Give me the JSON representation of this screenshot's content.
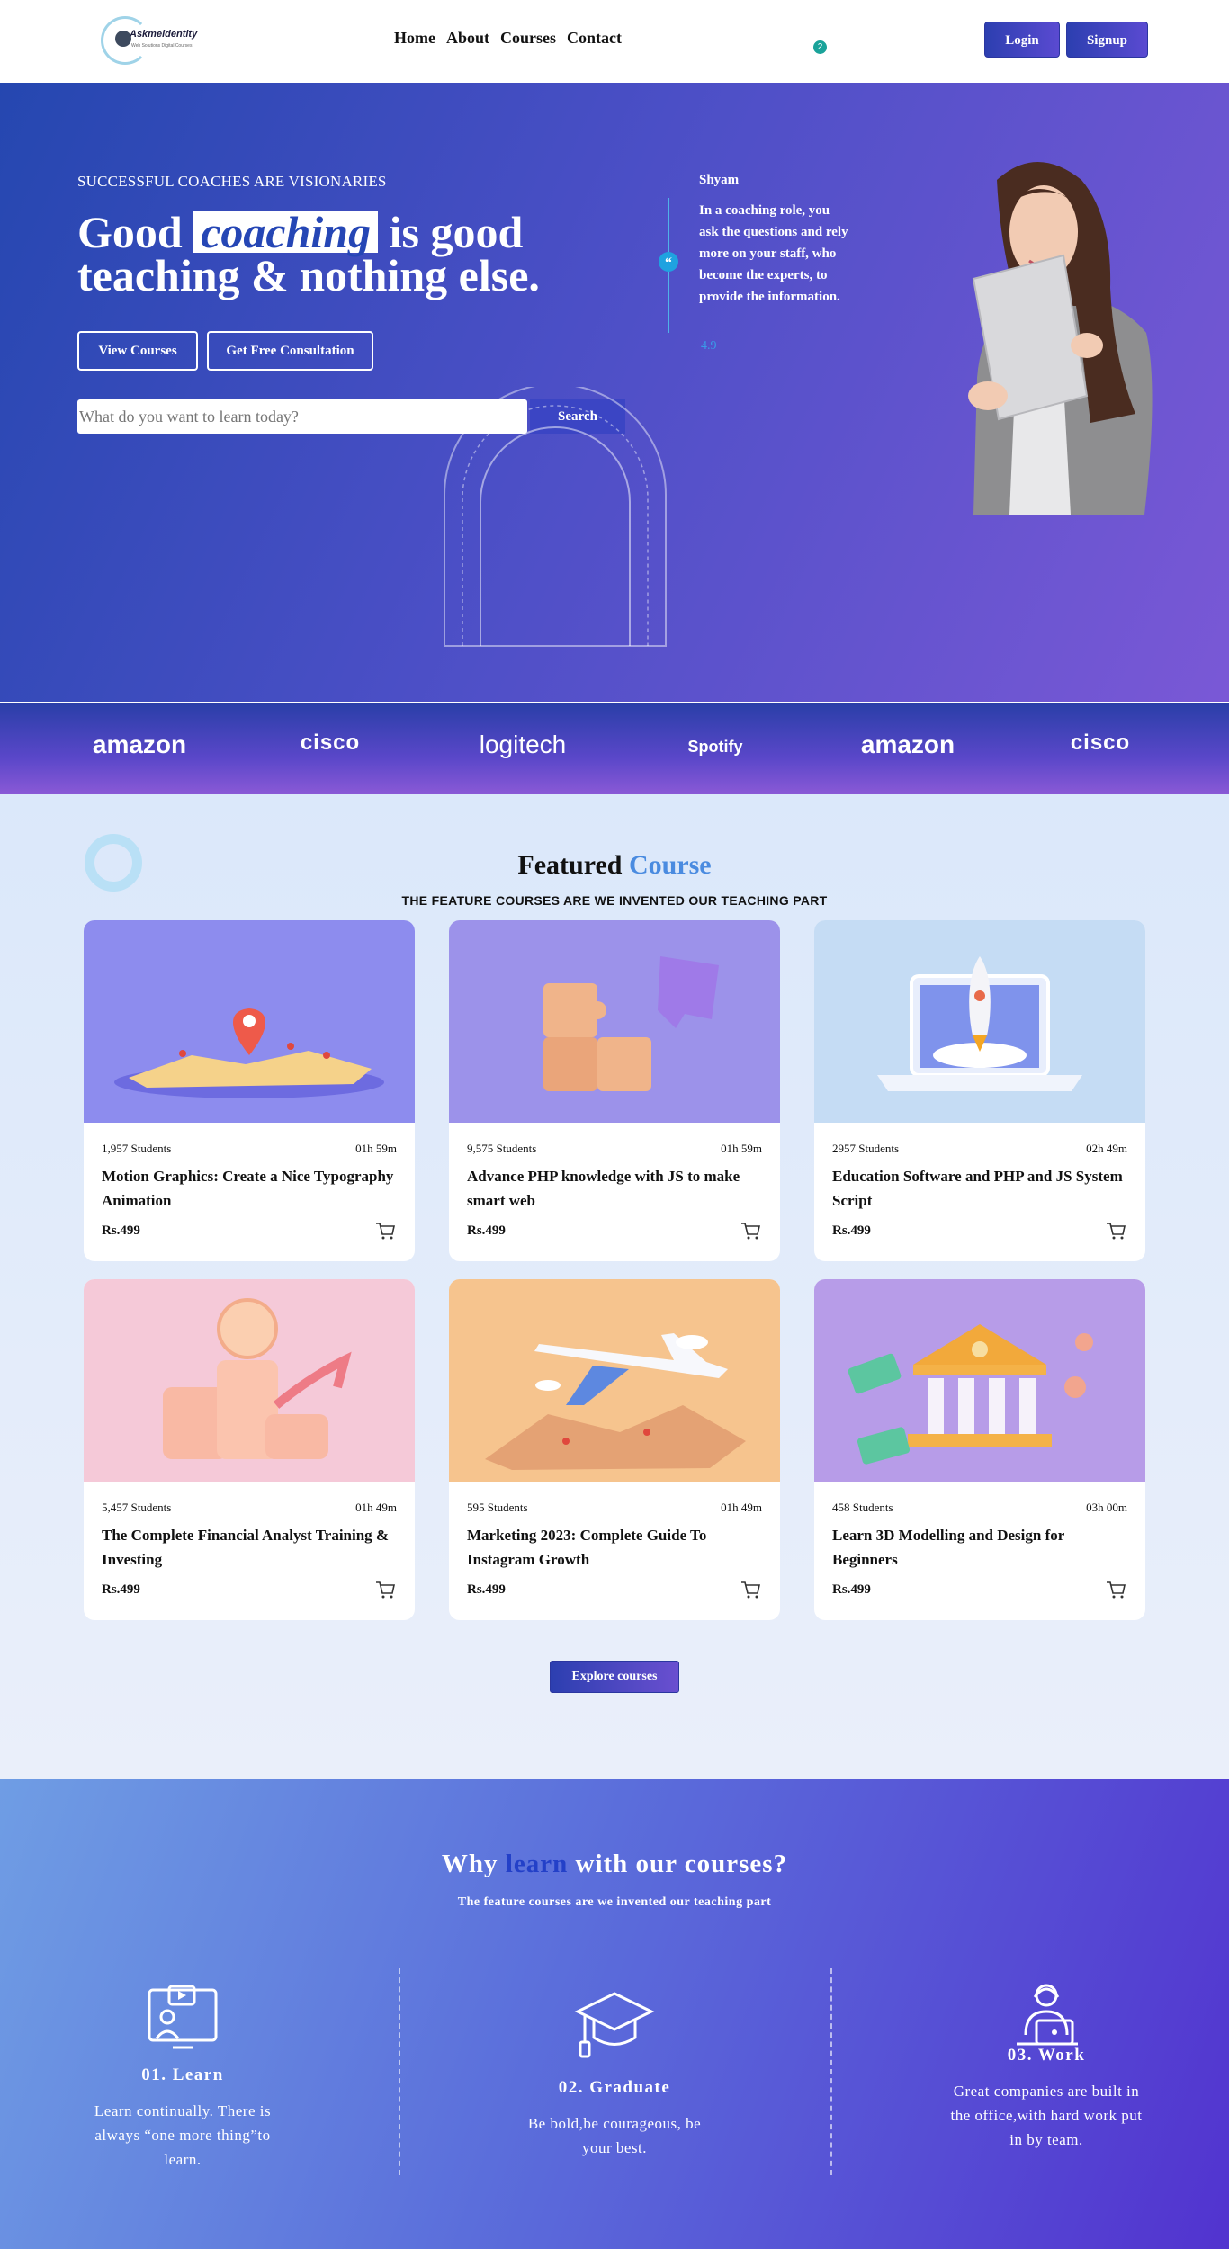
{
  "nav": {
    "logo_text": "Askmeidentity",
    "logo_sub": "Web Solutions Digital Courses",
    "links": [
      "Home",
      "About",
      "Courses",
      "Contact"
    ],
    "cart_count": "2",
    "login": "Login",
    "signup": "Signup"
  },
  "hero": {
    "eyebrow": "SUCCESSFUL COACHES ARE VISIONARIES",
    "headline_pre": "Good",
    "headline_highlight": "coaching",
    "headline_post": "is good teaching & nothing else.",
    "btn_view": "View Courses",
    "btn_consult": "Get Free Consultation",
    "search_placeholder": "What do you want to learn today?",
    "search_btn": "Search",
    "quote_icon": "“",
    "quote_name": "Shyam",
    "quote_text": "In a coaching role, you ask the questions and rely more on your staff, who become the experts, to provide the information.",
    "quote_rating": "4.9"
  },
  "brands": [
    "amazon",
    "cisco",
    "logitech",
    "Spotify",
    "amazon",
    "cisco"
  ],
  "featured": {
    "title_main": "Featured",
    "title_accent": "Course",
    "subtitle": "THE FEATURE COURSES ARE WE INVENTED OUR TEACHING PART",
    "courses": [
      {
        "students": "1,957 Students",
        "duration": "01h 59m",
        "title": "Motion Graphics: Create a Nice Typography Animation",
        "price": "Rs.499"
      },
      {
        "students": "9,575 Students",
        "duration": "01h 59m",
        "title": "Advance PHP knowledge with JS to make smart web",
        "price": "Rs.499"
      },
      {
        "students": "2957 Students",
        "duration": "02h 49m",
        "title": "Education Software and PHP and JS System Script",
        "price": "Rs.499"
      },
      {
        "students": "5,457 Students",
        "duration": "01h 49m",
        "title": "The Complete Financial Analyst Training & Investing",
        "price": "Rs.499"
      },
      {
        "students": "595 Students",
        "duration": "01h 49m",
        "title": "Marketing 2023: Complete Guide To Instagram Growth",
        "price": "Rs.499"
      },
      {
        "students": "458 Students",
        "duration": "03h 00m",
        "title": "Learn 3D Modelling and Design for Beginners",
        "price": "Rs.499"
      }
    ],
    "explore": "Explore courses"
  },
  "why": {
    "title_pre": "Why",
    "title_accent": "learn",
    "title_post": "with our courses?",
    "subtitle": "The feature courses are we invented our teaching part",
    "steps": [
      {
        "title": "01. Learn",
        "text": "Learn continually. There is always “one more thing”to learn."
      },
      {
        "title": "02. Graduate",
        "text": "Be bold,be courageous, be your best."
      },
      {
        "title": "03. Work",
        "text": "Great companies are built in the office,with hard work put in by team."
      }
    ]
  },
  "colors": {
    "primary": "#2c3fb0",
    "accent": "#4a8be0",
    "hero_start": "#2547b0",
    "hero_end": "#7a58d6"
  }
}
